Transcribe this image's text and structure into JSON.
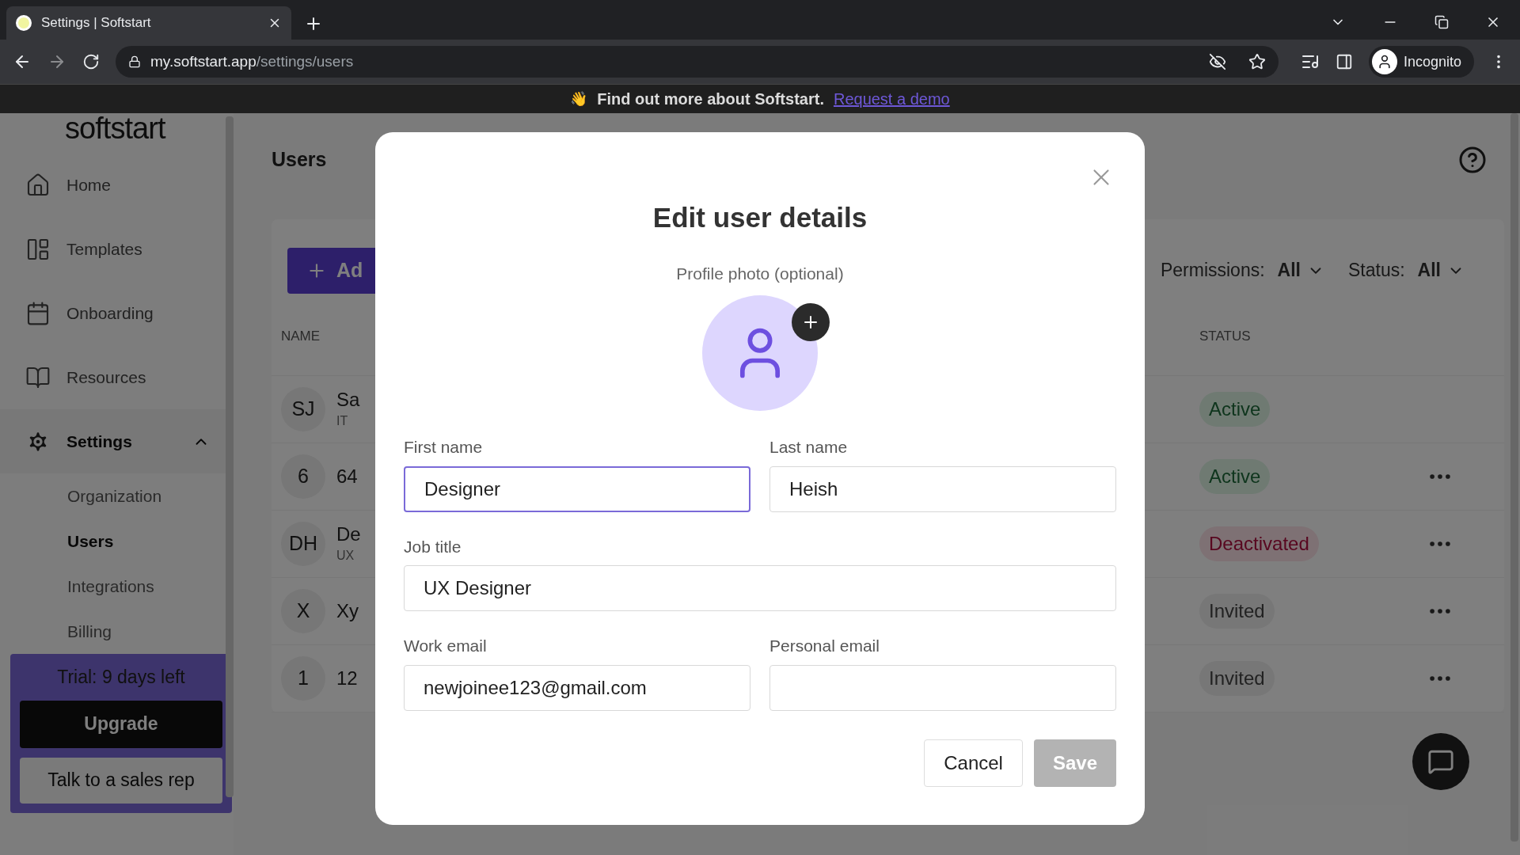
{
  "browser": {
    "tab_title": "Settings | Softstart",
    "url_host": "my.softstart.app",
    "url_path": "/settings/users",
    "profile_label": "Incognito"
  },
  "banner": {
    "icon": "👋",
    "text": "Find out more about Softstart.",
    "link": "Request a demo"
  },
  "sidebar": {
    "logo": "softstart",
    "items": [
      {
        "label": "Home",
        "kind": "home",
        "selected": false
      },
      {
        "label": "Templates",
        "kind": "templates",
        "selected": false
      },
      {
        "label": "Onboarding",
        "kind": "onboarding",
        "selected": false
      },
      {
        "label": "Resources",
        "kind": "resources",
        "selected": false
      },
      {
        "label": "Settings",
        "kind": "settings",
        "selected": true,
        "expanded": true
      }
    ],
    "sub_items": [
      {
        "label": "Organization",
        "selected": false
      },
      {
        "label": "Users",
        "selected": true
      },
      {
        "label": "Integrations",
        "selected": false
      },
      {
        "label": "Billing",
        "selected": false
      }
    ],
    "trial": {
      "text": "Trial: 9 days left",
      "upgrade": "Upgrade",
      "sales": "Talk to a sales rep"
    }
  },
  "main": {
    "title": "Users",
    "add_button": "Ad",
    "filters": [
      {
        "label": "Permissions:",
        "value": "All"
      },
      {
        "label": "Status:",
        "value": "All"
      }
    ],
    "columns": [
      "NAME",
      "STATUS"
    ],
    "rows": [
      {
        "initials": "SJ",
        "name": "Sa",
        "subtitle": "IT",
        "status": "Active",
        "kind": "active",
        "menu": false
      },
      {
        "initials": "6",
        "name": "64",
        "status": "Active",
        "kind": "active",
        "menu": true
      },
      {
        "initials": "DH",
        "name": "De",
        "subtitle": "UX",
        "status": "Deactivated",
        "kind": "deactivated",
        "menu": true
      },
      {
        "initials": "X",
        "name": "Xy",
        "status": "Invited",
        "kind": "invited",
        "menu": true
      },
      {
        "initials": "1",
        "name": "12",
        "status": "Invited",
        "kind": "invited",
        "menu": true
      }
    ]
  },
  "modal": {
    "title": "Edit user details",
    "photo_label": "Profile photo (optional)",
    "fields": [
      {
        "label": "First name",
        "value": "Designer",
        "focused": true,
        "kind": "half"
      },
      {
        "label": "Last name",
        "value": "Heish",
        "focused": false,
        "kind": "half"
      },
      {
        "label": "Job title",
        "value": "UX Designer",
        "focused": false,
        "kind": "full"
      },
      {
        "label": "Work email",
        "value": "newjoinee123@gmail.com",
        "focused": false,
        "kind": "half"
      },
      {
        "label": "Personal email",
        "focused": false,
        "kind": "half"
      }
    ],
    "cancel": "Cancel",
    "save": "Save",
    "save_disabled": true
  }
}
